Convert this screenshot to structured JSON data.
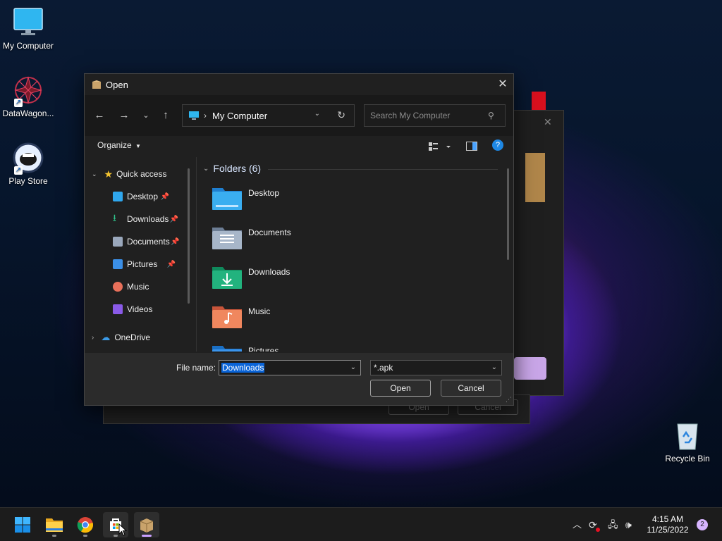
{
  "desktop": {
    "icons": [
      {
        "label": "My Computer"
      },
      {
        "label": "DataWagon..."
      },
      {
        "label": "Play Store"
      },
      {
        "label": "Recycle Bin"
      }
    ]
  },
  "background_dialog": {
    "open_label": "Open",
    "cancel_label": "Cancel"
  },
  "dialog": {
    "title": "Open",
    "close_glyph": "✕",
    "address": {
      "location": "My Computer"
    },
    "search": {
      "placeholder": "Search My Computer"
    },
    "toolbar": {
      "organize_label": "Organize"
    },
    "sidebar": {
      "quick_access": "Quick access",
      "items": [
        {
          "label": "Desktop",
          "icon": "desktop-icon",
          "pinned": true
        },
        {
          "label": "Downloads",
          "icon": "downloads-icon",
          "pinned": true
        },
        {
          "label": "Documents",
          "icon": "documents-icon",
          "pinned": true
        },
        {
          "label": "Pictures",
          "icon": "pictures-icon",
          "pinned": true
        },
        {
          "label": "Music",
          "icon": "music-icon",
          "pinned": false
        },
        {
          "label": "Videos",
          "icon": "videos-icon",
          "pinned": false
        }
      ],
      "onedrive": "OneDrive"
    },
    "content": {
      "group_title": "Folders (6)",
      "folders": [
        {
          "label": "Desktop",
          "color": "#2d9fe6"
        },
        {
          "label": "Documents",
          "color": "#8fa2bd"
        },
        {
          "label": "Downloads",
          "color": "#1fae7a"
        },
        {
          "label": "Music",
          "color": "#e8794a"
        },
        {
          "label": "Pictures",
          "color": "#2d8fe6"
        }
      ]
    },
    "bottom": {
      "file_name_label": "File name:",
      "file_name_value": "Downloads",
      "file_type_value": "*.apk",
      "open_label": "Open",
      "cancel_label": "Cancel"
    }
  },
  "taskbar": {
    "apps": [
      {
        "name": "start"
      },
      {
        "name": "file-explorer"
      },
      {
        "name": "chrome"
      },
      {
        "name": "store"
      },
      {
        "name": "package-app"
      }
    ],
    "time": "4:15 AM",
    "date": "11/25/2022",
    "notifications": "2"
  }
}
